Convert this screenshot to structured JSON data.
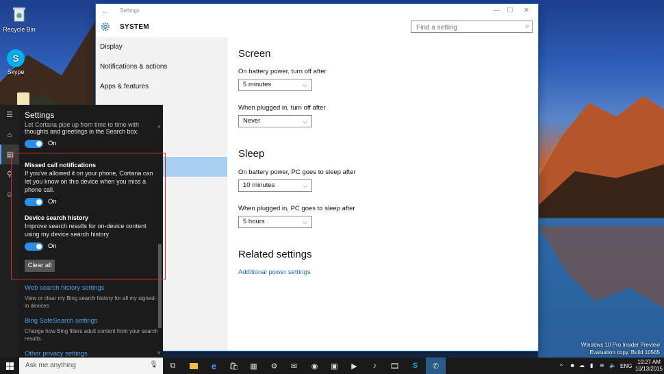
{
  "desktop": {
    "icons": [
      {
        "label": "Recycle Bin",
        "icon": "recycle-bin-icon"
      },
      {
        "label": "Skype",
        "icon": "skype-icon"
      }
    ],
    "watermark": {
      "line1": "Windows 10 Pro Insider Preview",
      "line2": "Evaluation copy. Build 10565"
    }
  },
  "settings_window": {
    "title": "Settings",
    "header": "SYSTEM",
    "search_placeholder": "Find a setting",
    "nav": [
      "Display",
      "Notifications & actions",
      "Apps & features"
    ],
    "screen": {
      "title": "Screen",
      "battery_label": "On battery power, turn off after",
      "battery_value": "5 minutes",
      "plugged_label": "When plugged in, turn off after",
      "plugged_value": "Never"
    },
    "sleep": {
      "title": "Sleep",
      "battery_label": "On battery power, PC goes to sleep after",
      "battery_value": "10 minutes",
      "plugged_label": "When plugged in, PC goes to sleep after",
      "plugged_value": "5 hours"
    },
    "related": {
      "title": "Related settings",
      "link": "Additional power settings"
    }
  },
  "cortana": {
    "title": "Settings",
    "top_text_1": "Let Cortana pipe up from time to time with",
    "top_text_2": "thoughts and greetings in the Search box.",
    "toggle1": "On",
    "missed_title": "Missed call notifications",
    "missed_1": "If you've allowed it on your phone, Cortana can",
    "missed_2": "let you know on this device when you miss a",
    "missed_3": "phone call.",
    "toggle2": "On",
    "history_title": "Device search history",
    "history_1": "Improve search results for on-device content",
    "history_2": "using my device search history",
    "toggle3": "On",
    "clear_all": "Clear all",
    "web_history_link": "Web search history settings",
    "web_history_desc_1": "View or clear my Bing search history for all my signed-",
    "web_history_desc_2": "in devices",
    "safesearch_link": "Bing SafeSearch settings",
    "safesearch_desc_1": "Change how Bing filters adult content from your search",
    "safesearch_desc_2": "results.",
    "other_privacy_link": "Other privacy settings"
  },
  "taskbar": {
    "ask_placeholder": "Ask me anything",
    "lang": "ENG",
    "time": "10:27 AM",
    "date": "10/13/2015"
  },
  "colors": {
    "accent": "#2b8ee6",
    "highlight_box": "#e0262c",
    "link": "#1a70b8"
  }
}
